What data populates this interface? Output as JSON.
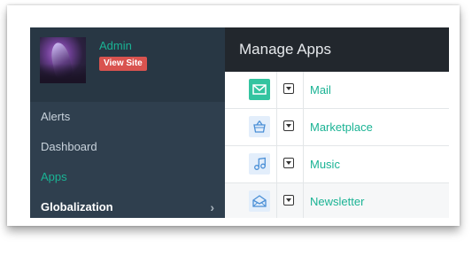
{
  "sidebar": {
    "user": {
      "name": "Admin",
      "view_site_label": "View Site"
    },
    "items": [
      {
        "label": "Alerts",
        "state": "normal"
      },
      {
        "label": "Dashboard",
        "state": "normal"
      },
      {
        "label": "Apps",
        "state": "active"
      },
      {
        "label": "Globalization",
        "state": "expandable"
      }
    ]
  },
  "header": {
    "title": "Manage Apps"
  },
  "apps": [
    {
      "name": "Mail",
      "icon": "mail-icon"
    },
    {
      "name": "Marketplace",
      "icon": "basket-icon"
    },
    {
      "name": "Music",
      "icon": "music-note-icon"
    },
    {
      "name": "Newsletter",
      "icon": "envelope-open-icon"
    }
  ],
  "colors": {
    "accent": "#1ab394",
    "sidebar": "#2f3f4e",
    "topbar": "#22272d",
    "badge": "#d9534f"
  }
}
